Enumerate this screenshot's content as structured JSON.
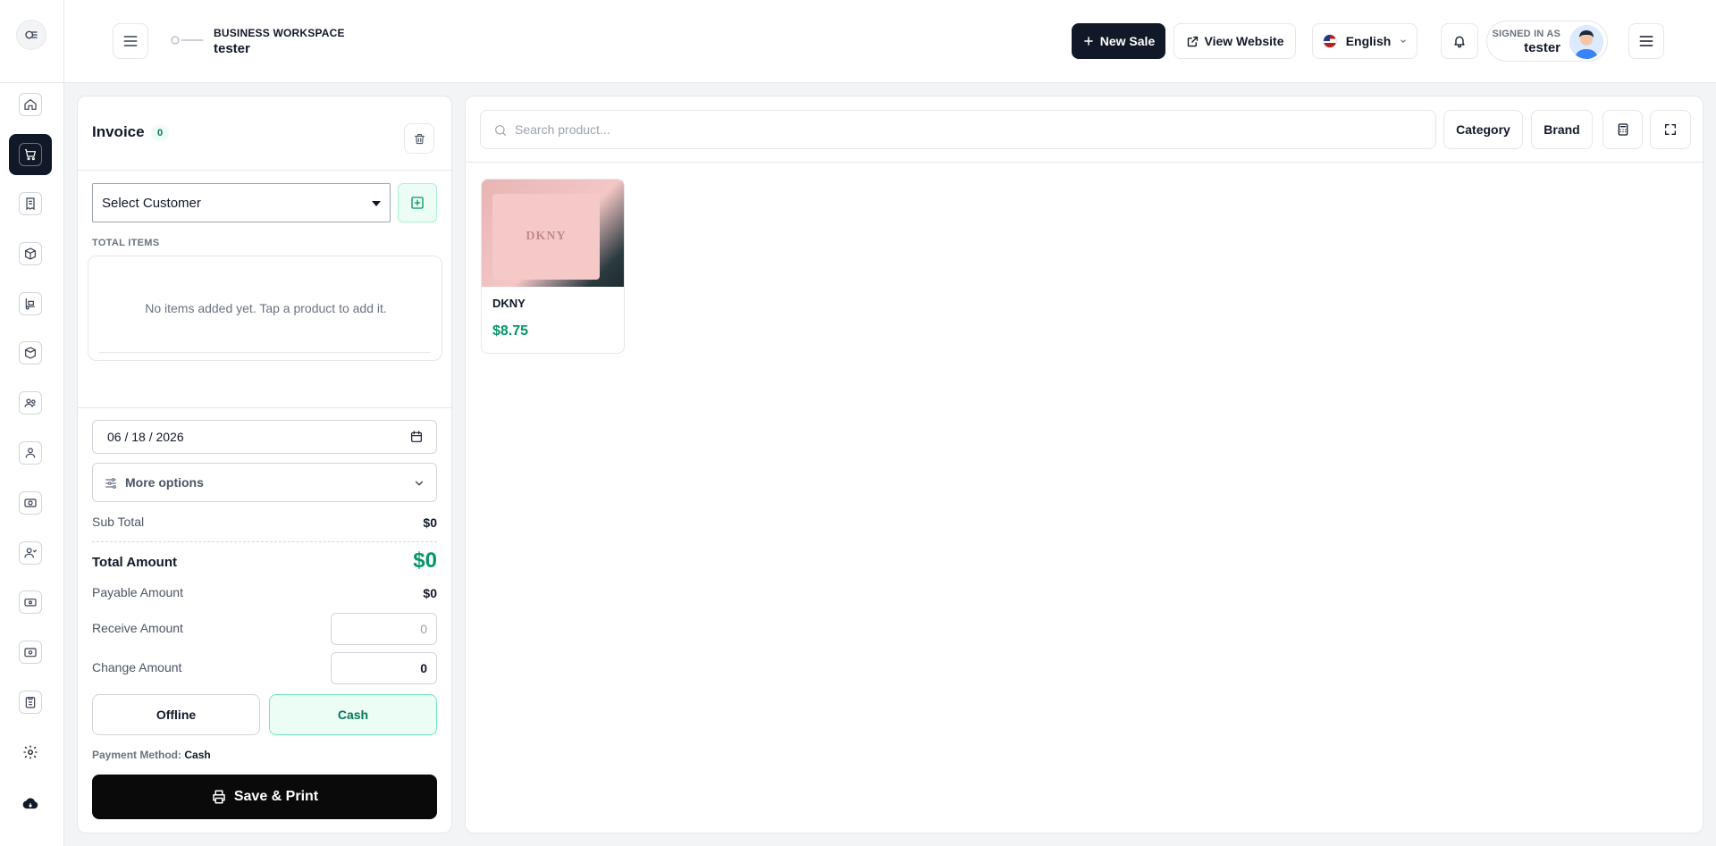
{
  "header": {
    "workspace_label": "BUSINESS WORKSPACE",
    "workspace_name": "tester",
    "new_sale": "New Sale",
    "view_website": "View Website",
    "language": "English",
    "signed_in_label": "SIGNED IN AS",
    "signed_in_user": "tester"
  },
  "invoice": {
    "title": "Invoice",
    "count": "0",
    "customer_select": "Select Customer",
    "total_items_label": "TOTAL ITEMS",
    "empty_text": "No items added yet. Tap a product to add it.",
    "date": "06 / 18 / 2026",
    "more_options": "More options",
    "sub_total_label": "Sub Total",
    "sub_total": "$0",
    "total_amount_label": "Total Amount",
    "total_amount": "$0",
    "payable_label": "Payable Amount",
    "payable": "$0",
    "receive_label": "Receive Amount",
    "receive_placeholder": "0",
    "change_label": "Change Amount",
    "change": "0",
    "offline_label": "Offline",
    "cash_label": "Cash",
    "payment_method_label": "Payment Method:",
    "payment_method": "Cash",
    "save_print": "Save & Print"
  },
  "products": {
    "search_placeholder": "Search product...",
    "category_label": "Category",
    "brand_label": "Brand",
    "items": [
      {
        "name": "DKNY",
        "price": "$8.75",
        "image_text": "DKNY"
      }
    ]
  },
  "colors": {
    "accent_green": "#059669",
    "dark": "#111827"
  }
}
